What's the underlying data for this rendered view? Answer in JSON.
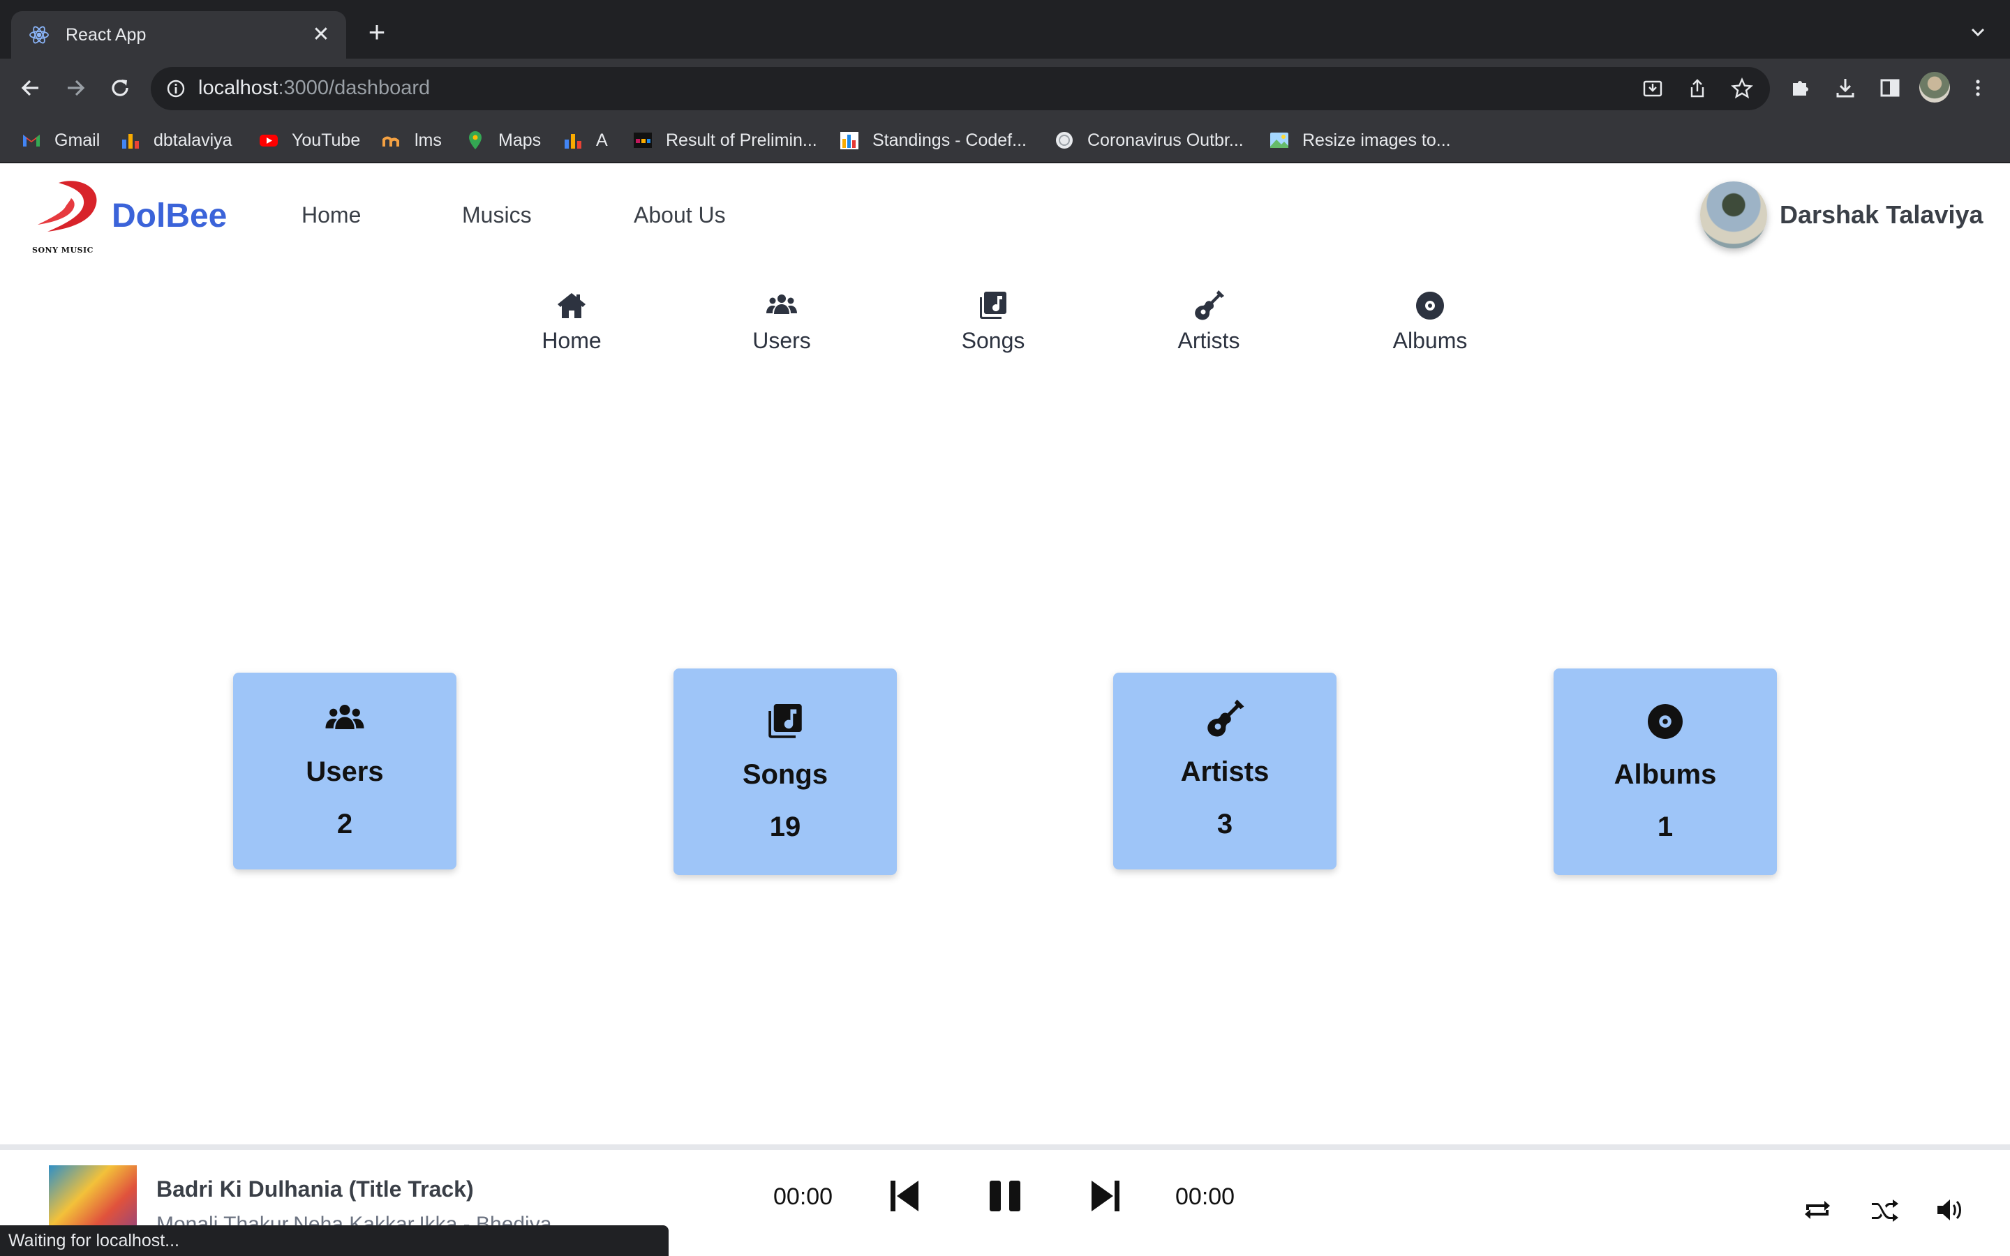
{
  "browser": {
    "tab_title": "React App",
    "tab_close": "✕",
    "new_tab": "+",
    "url_host": "localhost",
    "url_rest": ":3000/dashboard",
    "bookmarks": [
      {
        "label": "Gmail",
        "icon": "gmail-icon",
        "color": "#ea4335"
      },
      {
        "label": "dbtalaviya",
        "icon": "bar-chart-icon",
        "color": "#f9ab00"
      },
      {
        "label": "YouTube",
        "icon": "youtube-icon",
        "color": "#ff0000"
      },
      {
        "label": "lms",
        "icon": "lms-icon",
        "color": "#f4a142"
      },
      {
        "label": "Maps",
        "icon": "maps-icon",
        "color": "#34a853"
      },
      {
        "label": "A",
        "icon": "bar-chart-icon",
        "color": "#f9ab00"
      },
      {
        "label": "Result of Prelimin...",
        "icon": "result-icon",
        "color": "#c2185b"
      },
      {
        "label": "Standings - Codef...",
        "icon": "codeforces-icon",
        "color": "#1e88e5"
      },
      {
        "label": "Coronavirus Outbr...",
        "icon": "globe-icon",
        "color": "#e8eaed"
      },
      {
        "label": "Resize images to...",
        "icon": "image-icon",
        "color": "#66bb6a"
      }
    ],
    "status": "Waiting for localhost..."
  },
  "app": {
    "brand": "DolBee",
    "logo_caption": "SONY MUSIC",
    "nav": [
      "Home",
      "Musics",
      "About Us"
    ],
    "user_name": "Darshak Talaviya",
    "dashboard_tabs": [
      {
        "label": "Home",
        "icon": "home-icon"
      },
      {
        "label": "Users",
        "icon": "users-icon"
      },
      {
        "label": "Songs",
        "icon": "music-library-icon"
      },
      {
        "label": "Artists",
        "icon": "guitar-icon"
      },
      {
        "label": "Albums",
        "icon": "record-icon"
      }
    ],
    "cards": [
      {
        "title": "Users",
        "count": "2",
        "icon": "users-icon"
      },
      {
        "title": "Songs",
        "count": "19",
        "icon": "music-library-icon"
      },
      {
        "title": "Artists",
        "count": "3",
        "icon": "guitar-icon"
      },
      {
        "title": "Albums",
        "count": "1",
        "icon": "record-icon"
      }
    ],
    "card_color": "#9ec5f8",
    "brand_color": "#3b63d9"
  },
  "player": {
    "title": "Badri Ki Dulhania (Title Track)",
    "artist": "Monali Thakur,Neha Kakkar,Ikka - Bhediya",
    "current_time": "00:00",
    "duration": "00:00"
  }
}
